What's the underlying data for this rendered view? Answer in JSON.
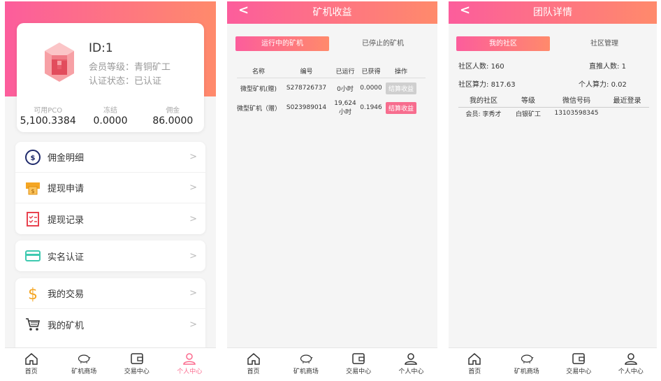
{
  "profile": {
    "id_text": "ID:1",
    "level_text": "会员等级：青铜矿工",
    "verify_text": "认证状态：已认证",
    "stats": [
      {
        "label": "可用PCO",
        "value": "5,100.3384"
      },
      {
        "label": "冻结",
        "value": "0.0000"
      },
      {
        "label": "佣金",
        "value": "86.0000"
      }
    ]
  },
  "menu_group1": [
    {
      "label": "佣金明细",
      "icon": "dollar-icon"
    },
    {
      "label": "提现申请",
      "icon": "withdraw-icon"
    },
    {
      "label": "提现记录",
      "icon": "record-icon"
    }
  ],
  "menu_group2": [
    {
      "label": "实名认证",
      "icon": "card-icon"
    }
  ],
  "menu_group3": [
    {
      "label": "我的交易",
      "icon": "dollar-sign-icon"
    },
    {
      "label": "我的矿机",
      "icon": "cart-icon"
    }
  ],
  "chevron": ">",
  "tabbar": [
    {
      "label": "首页",
      "icon": "home-icon"
    },
    {
      "label": "矿机商场",
      "icon": "pig-icon"
    },
    {
      "label": "交易中心",
      "icon": "wallet-icon"
    },
    {
      "label": "个人中心",
      "icon": "user-icon"
    }
  ],
  "back_glyph": "<",
  "earnings": {
    "title": "矿机收益",
    "tabs": [
      "运行中的矿机",
      "已停止的矿机"
    ],
    "headers": [
      "名称",
      "编号",
      "已运行",
      "已获得",
      "操作"
    ],
    "rows": [
      {
        "name": "微型矿机(赠)",
        "code": "S278726737",
        "run": "0小时",
        "earned": "0.0000",
        "action": "结算收益",
        "enabled": false
      },
      {
        "name": "微型矿机（赠）",
        "code": "S023989014",
        "run": "19,624小时",
        "earned": "0.1946",
        "action": "结算收益",
        "enabled": true
      }
    ]
  },
  "team": {
    "title": "团队详情",
    "tabs": [
      "我的社区",
      "社区管理"
    ],
    "community_count_label": "社区人数:",
    "community_count": "160",
    "direct_label": "直推人数:",
    "direct_count": "1",
    "community_power_label": "社区算力:",
    "community_power": "817.63",
    "personal_power_label": "个人算力:",
    "personal_power": "0.02",
    "headers": [
      "我的社区",
      "等级",
      "微信号码",
      "最近登录"
    ],
    "rows": [
      {
        "member": "会员: 李秀才",
        "level": "白银矿工",
        "wechat": "13103598345",
        "last_login": ""
      }
    ]
  },
  "colors": {
    "accent_start": "#fc5d9c",
    "accent_end": "#ff8a6b"
  }
}
